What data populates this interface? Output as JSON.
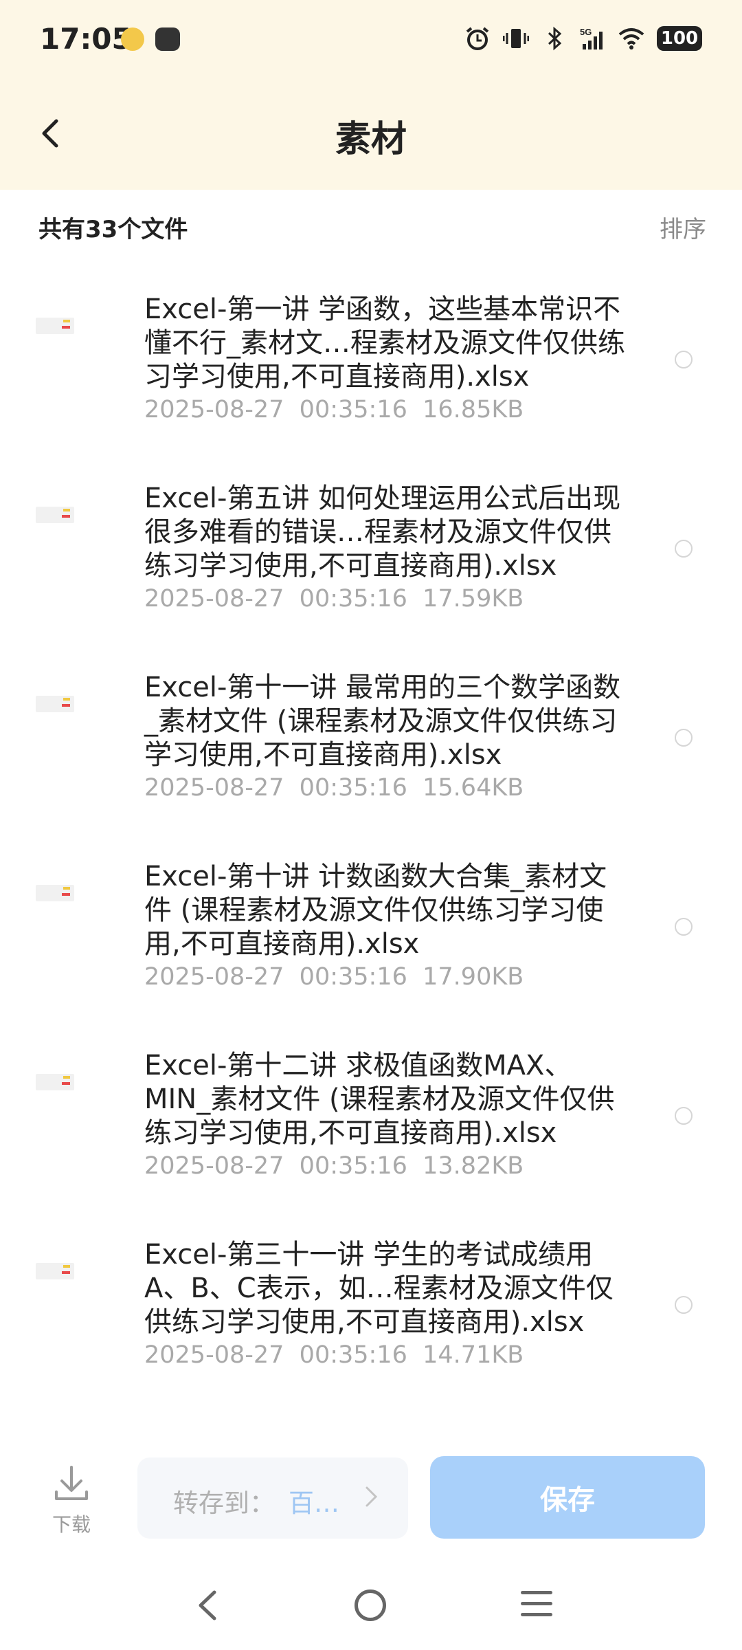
{
  "status": {
    "time": "17:05",
    "battery": "100",
    "network": "5G"
  },
  "header": {
    "title": "素材"
  },
  "summary": {
    "count_text": "共有33个文件",
    "sort_label": "排序"
  },
  "files": [
    {
      "name": "Excel-第一讲 学函数，这些基本常识不懂不行_素材文…程素材及源文件仅供练习学习使用,不可直接商用).xlsx",
      "date": "2025-08-27",
      "time": "00:35:16",
      "size": "16.85KB"
    },
    {
      "name": "Excel-第五讲 如何处理运用公式后出现很多难看的错误…程素材及源文件仅供练习学习使用,不可直接商用).xlsx",
      "date": "2025-08-27",
      "time": "00:35:16",
      "size": "17.59KB"
    },
    {
      "name": "Excel-第十一讲 最常用的三个数学函数_素材文件 (课程素材及源文件仅供练习学习使用,不可直接商用).xlsx",
      "date": "2025-08-27",
      "time": "00:35:16",
      "size": "15.64KB"
    },
    {
      "name": "Excel-第十讲 计数函数大合集_素材文件 (课程素材及源文件仅供练习学习使用,不可直接商用).xlsx",
      "date": "2025-08-27",
      "time": "00:35:16",
      "size": "17.90KB"
    },
    {
      "name": "Excel-第十二讲 求极值函数MAX、MIN_素材文件 (课程素材及源文件仅供练习学习使用,不可直接商用).xlsx",
      "date": "2025-08-27",
      "time": "00:35:16",
      "size": "13.82KB"
    },
    {
      "name": "Excel-第三十一讲 学生的考试成绩用A、B、C表示，如…程素材及源文件仅供练习学习使用,不可直接商用).xlsx",
      "date": "2025-08-27",
      "time": "00:35:16",
      "size": "14.71KB"
    }
  ],
  "bottom": {
    "download_label": "下载",
    "transfer_label": "转存到：",
    "transfer_target": "百…",
    "save_label": "保存"
  },
  "colors": {
    "header_bg": "#fdf7e6",
    "save_button": "#a9d0fa",
    "target_text": "#9ec6f3"
  }
}
